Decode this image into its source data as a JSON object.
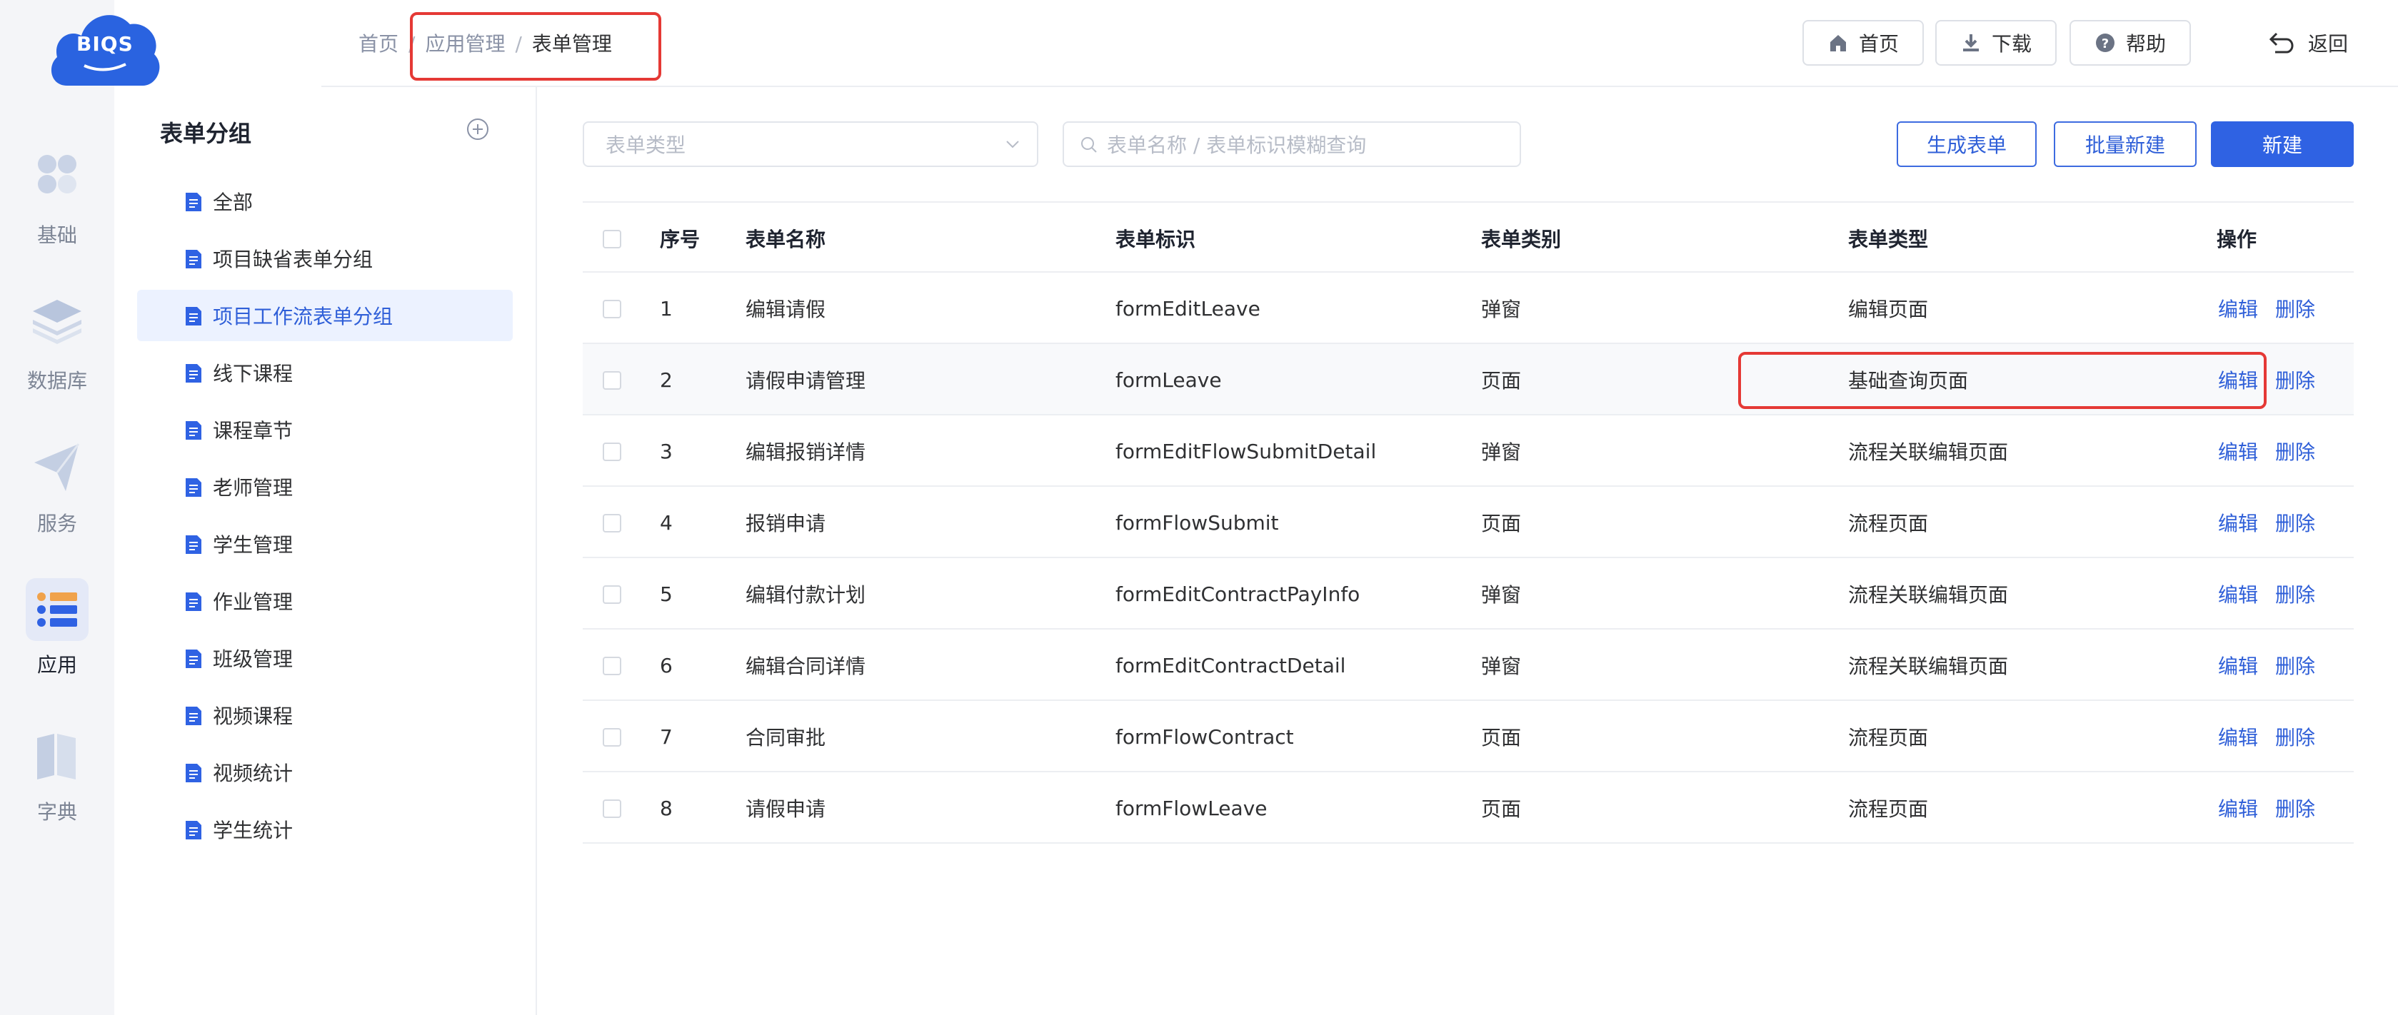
{
  "logo": {
    "text": "BIQS"
  },
  "rail": [
    {
      "label": "基础",
      "icon": "grid-icon"
    },
    {
      "label": "数据库",
      "icon": "layers-icon"
    },
    {
      "label": "服务",
      "icon": "send-icon"
    },
    {
      "label": "应用",
      "icon": "app-list-icon",
      "active": true
    },
    {
      "label": "字典",
      "icon": "book-icon"
    }
  ],
  "breadcrumb": {
    "home": "首页",
    "app": "应用管理",
    "current": "表单管理",
    "separator": "/"
  },
  "header": {
    "home_label": "首页",
    "download_label": "下载",
    "help_label": "帮助",
    "back_label": "返回"
  },
  "groups": {
    "title": "表单分组",
    "items": [
      {
        "label": "全部"
      },
      {
        "label": "项目缺省表单分组"
      },
      {
        "label": "项目工作流表单分组"
      },
      {
        "label": "线下课程"
      },
      {
        "label": "课程章节"
      },
      {
        "label": "老师管理"
      },
      {
        "label": "学生管理"
      },
      {
        "label": "作业管理"
      },
      {
        "label": "班级管理"
      },
      {
        "label": "视频课程"
      },
      {
        "label": "视频统计"
      },
      {
        "label": "学生统计"
      }
    ],
    "active_index": 2
  },
  "toolbar": {
    "type_placeholder": "表单类型",
    "search_placeholder": "表单名称 / 表单标识模糊查询",
    "generate_label": "生成表单",
    "batch_label": "批量新建",
    "new_label": "新建"
  },
  "table": {
    "headers": {
      "index": "序号",
      "name": "表单名称",
      "id": "表单标识",
      "category": "表单类别",
      "type": "表单类型",
      "actions": "操作"
    },
    "edit_label": "编辑",
    "delete_label": "删除",
    "rows": [
      {
        "index": "1",
        "name": "编辑请假",
        "id": "formEditLeave",
        "category": "弹窗",
        "type": "编辑页面"
      },
      {
        "index": "2",
        "name": "请假申请管理",
        "id": "formLeave",
        "category": "页面",
        "type": "基础查询页面"
      },
      {
        "index": "3",
        "name": "编辑报销详情",
        "id": "formEditFlowSubmitDetail",
        "category": "弹窗",
        "type": "流程关联编辑页面"
      },
      {
        "index": "4",
        "name": "报销申请",
        "id": "formFlowSubmit",
        "category": "页面",
        "type": "流程页面"
      },
      {
        "index": "5",
        "name": "编辑付款计划",
        "id": "formEditContractPayInfo",
        "category": "弹窗",
        "type": "流程关联编辑页面"
      },
      {
        "index": "6",
        "name": "编辑合同详情",
        "id": "formEditContractDetail",
        "category": "弹窗",
        "type": "流程关联编辑页面"
      },
      {
        "index": "7",
        "name": "合同审批",
        "id": "formFlowContract",
        "category": "页面",
        "type": "流程页面"
      },
      {
        "index": "8",
        "name": "请假申请",
        "id": "formFlowLeave",
        "category": "页面",
        "type": "流程页面"
      }
    ]
  },
  "colors": {
    "accent": "#2f62e3",
    "highlight": "#e53935",
    "rail_bg": "#f4f5f8"
  }
}
